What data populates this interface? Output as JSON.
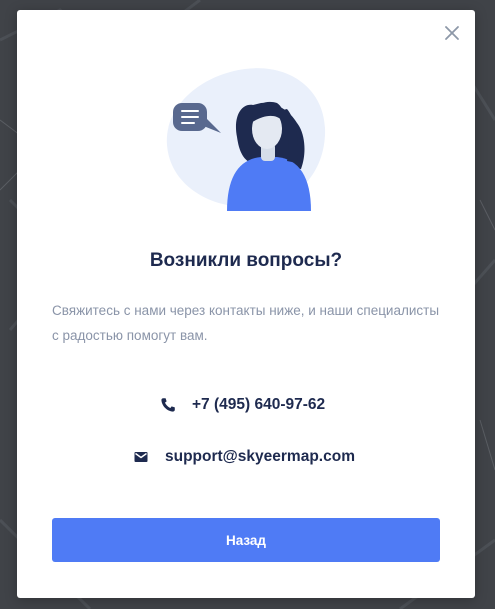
{
  "dialog": {
    "title": "Возникли вопросы?",
    "description": "Свяжитесь с нами через контакты ниже, и наши специалисты с радостью помогут вам.",
    "close_icon": "close-icon",
    "illustration": "support-agent-illustration"
  },
  "contacts": {
    "phone": {
      "icon": "phone-icon",
      "value": "+7 (495) 640-97-62"
    },
    "email": {
      "icon": "mail-icon",
      "value": "support@skyeermap.com"
    }
  },
  "actions": {
    "back_label": "Назад"
  },
  "colors": {
    "accent": "#4f7bf5",
    "title": "#1e2a4f",
    "muted_text": "#8a94a8",
    "backdrop": "#3f4247",
    "illustration_bg": "#eaf0fb",
    "illustration_figure": "#4f7bf5",
    "hair": "#1e2a4f"
  }
}
